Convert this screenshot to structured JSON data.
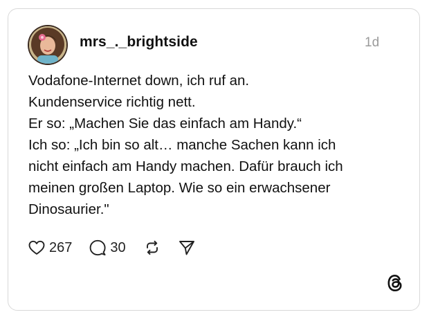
{
  "post": {
    "username": "mrs_._brightside",
    "time": "1d",
    "text_lines": [
      "Vodafone-Internet down, ich ruf an.",
      "Kundenservice richtig nett.",
      "Er so: „Machen Sie das einfach am Handy.“",
      "Ich so: „Ich bin so alt… manche Sachen kann ich",
      "nicht einfach am Handy machen. Dafür brauch ich",
      "meinen großen Laptop. Wie so ein erwachsener",
      "Dinosaurier.\""
    ],
    "likes": "267",
    "replies": "30"
  },
  "icons": {
    "like": "heart-icon",
    "reply": "comment-bubble-icon",
    "repost": "repost-icon",
    "share": "send-icon",
    "brand": "threads-logo-icon"
  },
  "colors": {
    "border": "#d8d8d8",
    "text": "#111111",
    "muted": "#9a9a9a"
  }
}
